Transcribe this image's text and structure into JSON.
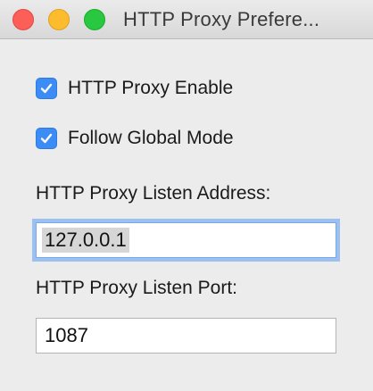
{
  "window": {
    "title": "HTTP Proxy Prefere..."
  },
  "traffic_lights": {
    "close": "close",
    "minimize": "minimize",
    "zoom": "zoom"
  },
  "options": {
    "proxy_enable": {
      "label": "HTTP Proxy Enable",
      "checked": true
    },
    "follow_global": {
      "label": "Follow Global Mode",
      "checked": true
    }
  },
  "listen_address": {
    "label": "HTTP Proxy Listen Address:",
    "value": "127.0.0.1"
  },
  "listen_port": {
    "label": "HTTP Proxy Listen Port:",
    "value": "1087"
  },
  "colors": {
    "checkbox_accent": "#3b8cf5",
    "focus_ring": "#9cc0f0"
  }
}
